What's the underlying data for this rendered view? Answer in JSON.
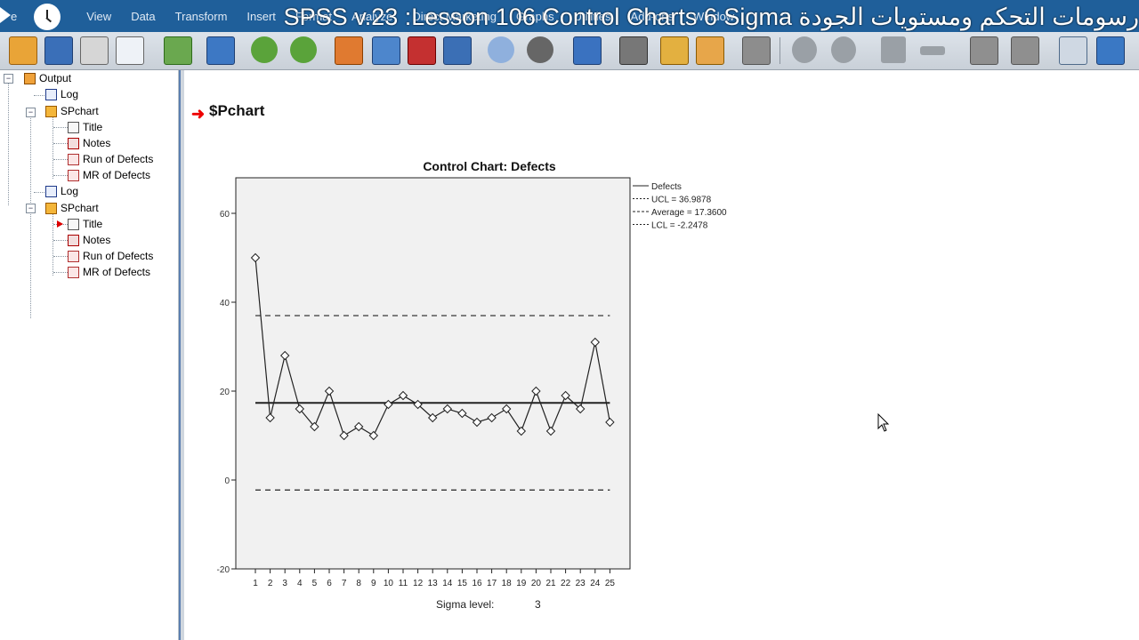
{
  "menubar": {
    "items": [
      "e",
      "View",
      "Data",
      "Transform",
      "Insert",
      "Format",
      "Analyze",
      "Direct Marketing",
      "Graphs",
      "Utilities",
      "Add-ons",
      "Window"
    ],
    "video_title": "SPSS v.23 :Lesson 106 Control Charts 6 Sigma رسومات التحكم ومستويات الجودة"
  },
  "toolbar": {
    "icons": [
      "open-icon",
      "save-icon",
      "print-icon",
      "print-preview-icon",
      "export-icon",
      "data-editor-icon",
      "undo-icon",
      "redo-icon",
      "goto-data-icon",
      "goto-variable-icon",
      "insert-icon",
      "variables-icon",
      "select-cases-icon",
      "weight-icon",
      "split-icon",
      "value-labels-icon",
      "show-all-icon",
      "designate-window-icon",
      "back-icon",
      "forward-icon",
      "expand-icon",
      "collapse-icon",
      "show-icon",
      "hide-icon",
      "title-icon",
      "text-icon"
    ]
  },
  "tree": {
    "nodes": [
      {
        "label": "Output",
        "icon": "output-icon"
      },
      {
        "label": "Log",
        "icon": "log-icon"
      },
      {
        "label": "SPchart",
        "icon": "chart-icon"
      },
      {
        "label": "Title",
        "icon": "title-icon"
      },
      {
        "label": "Notes",
        "icon": "notes-icon"
      },
      {
        "label": "Run of Defects",
        "icon": "graph-icon"
      },
      {
        "label": "MR of Defects",
        "icon": "graph-icon"
      },
      {
        "label": "Log",
        "icon": "log-icon"
      },
      {
        "label": "SPchart",
        "icon": "chart-icon"
      },
      {
        "label": "Title",
        "icon": "title-icon"
      },
      {
        "label": "Notes",
        "icon": "notes-icon"
      },
      {
        "label": "Run of Defects",
        "icon": "graph-icon"
      },
      {
        "label": "MR of Defects",
        "icon": "graph-icon"
      }
    ]
  },
  "content": {
    "section_title": "$Pchart",
    "colors": {
      "accent": "#e00000",
      "titlebar": "#1f5f9a",
      "plot_bg": "#f1f1f1"
    }
  },
  "chart_data": {
    "type": "line",
    "title": "Control Chart: Defects",
    "x": [
      1,
      2,
      3,
      4,
      5,
      6,
      7,
      8,
      9,
      10,
      11,
      12,
      13,
      14,
      15,
      16,
      17,
      18,
      19,
      20,
      21,
      22,
      23,
      24,
      25
    ],
    "series": [
      {
        "name": "Defects",
        "values": [
          50,
          14,
          28,
          16,
          12,
          20,
          10,
          12,
          10,
          17,
          19,
          17,
          14,
          16,
          15,
          13,
          14,
          16,
          11,
          20,
          11,
          19,
          16,
          31,
          13
        ]
      }
    ],
    "ucl": 36.9878,
    "average": 17.36,
    "lcl": -2.2478,
    "legend": [
      "Defects",
      "UCL = 36.9878",
      "Average = 17.3600",
      "LCL = -2.2478"
    ],
    "legend_placement": "right-top",
    "ylim": [
      -20,
      68
    ],
    "yticks": [
      -20,
      0,
      20,
      40,
      60
    ],
    "xlabel": "Sigma level:",
    "sigma_level": "3"
  }
}
